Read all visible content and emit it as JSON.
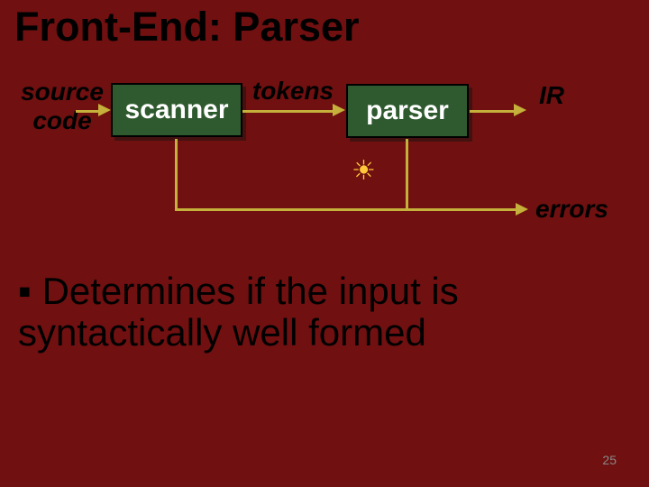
{
  "title": "Front-End: Parser",
  "diagram": {
    "source_label": "source\ncode",
    "scanner_box": "scanner",
    "tokens_label": "tokens",
    "parser_box": "parser",
    "ir_label": "IR",
    "errors_label": "errors"
  },
  "bullets": {
    "item1": "Determines if the input is syntactically well formed"
  },
  "page_number": "25"
}
